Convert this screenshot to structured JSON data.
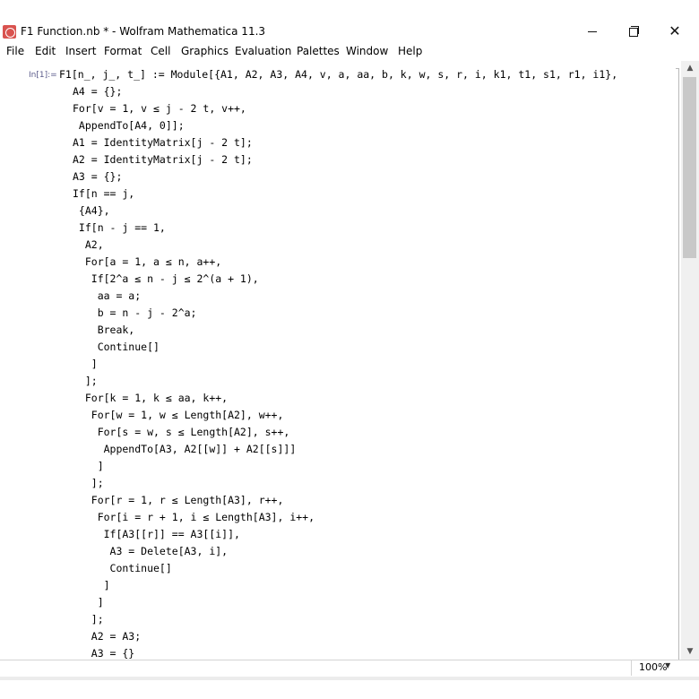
{
  "window": {
    "title": "F1  Function.nb * - Wolfram Mathematica 11.3",
    "minimize_symbol": "",
    "maximize_symbol": "",
    "close_symbol": "✕"
  },
  "menu": [
    "File",
    "Edit",
    "Insert",
    "Format",
    "Cell",
    "Graphics",
    "Evaluation",
    "Palettes",
    "Window",
    "Help"
  ],
  "cell": {
    "label": "In[1]:=",
    "lines": [
      "F1[n_, j_, t_] := Module[{A1, A2, A3, A4, v, a, aa, b, k, w, s, r, i, k1, t1, s1, r1, i1},",
      "A4 = {};",
      "For[v = 1, v ≤ j - 2 t, v++,",
      " AppendTo[A4, 0]];",
      "A1 = IdentityMatrix[j - 2 t];",
      "A2 = IdentityMatrix[j - 2 t];",
      "A3 = {};",
      "If[n == j,",
      " {A4},",
      " If[n - j == 1,",
      "  A2,",
      "  For[a = 1, a ≤ n, a++,",
      "   If[2^a ≤ n - j ≤ 2^(a + 1),",
      "    aa = a;",
      "    b = n - j - 2^a;",
      "    Break,",
      "    Continue[]",
      "   ]",
      "  ];",
      "  For[k = 1, k ≤ aa, k++,",
      "   For[w = 1, w ≤ Length[A2], w++,",
      "    For[s = w, s ≤ Length[A2], s++,",
      "     AppendTo[A3, A2[[w]] + A2[[s]]]",
      "    ]",
      "   ];",
      "   For[r = 1, r ≤ Length[A3], r++,",
      "    For[i = r + 1, i ≤ Length[A3], i++,",
      "     If[A3[[r]] == A3[[i]],",
      "      A3 = Delete[A3, i],",
      "      Continue[]",
      "     ]",
      "    ]",
      "   ];",
      "   A2 = A3;",
      "   A3 = {}"
    ]
  },
  "status": {
    "zoom": "100%",
    "zoom_arrow": "▼"
  },
  "scrollbar": {
    "up_arrow": "▲",
    "down_arrow": "▼"
  }
}
